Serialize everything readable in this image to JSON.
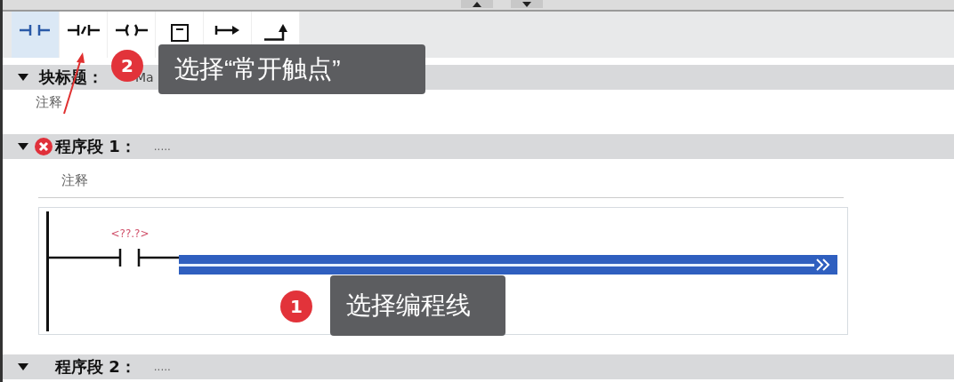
{
  "toolbar": {
    "buttons": [
      {
        "kind": "contact_no",
        "selected": true
      },
      {
        "kind": "contact_nc",
        "selected": false
      },
      {
        "kind": "coil",
        "selected": false
      },
      {
        "kind": "box",
        "selected": false
      },
      {
        "kind": "open_branch",
        "selected": false
      },
      {
        "kind": "close_branch",
        "selected": false
      }
    ]
  },
  "block_title": {
    "label": "块标题：",
    "value": "Ma",
    "comment": "注释",
    "expanded": true
  },
  "networks": [
    {
      "label": "程序段 1：",
      "title": ".....",
      "error": true,
      "expanded": true,
      "comment": "注释",
      "rung": {
        "operand": "<??.?>",
        "wire_selected": true
      }
    },
    {
      "label": "程序段 2：",
      "title": ".....",
      "error": false,
      "expanded": true
    }
  ],
  "callouts": [
    {
      "number": "2",
      "text": "选择“常开触点”"
    },
    {
      "number": "1",
      "text": "选择编程线"
    }
  ]
}
